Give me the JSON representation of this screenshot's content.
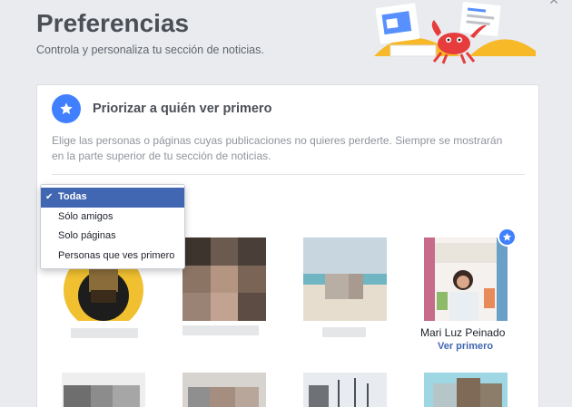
{
  "header": {
    "title": "Preferencias",
    "subtitle": "Controla y personaliza tu sección de noticias."
  },
  "section": {
    "title": "Priorizar a quién ver primero",
    "description": "Elige las personas o páginas cuyas publicaciones no quieres perderte. Siempre se mostrarán en la parte superior de tu sección de noticias."
  },
  "filter": {
    "options": [
      "Todas",
      "Sólo amigos",
      "Solo páginas",
      "Personas que ves primero"
    ],
    "selected": "Todas"
  },
  "people": [
    {
      "name": "",
      "see_first": false
    },
    {
      "name": "",
      "see_first": false
    },
    {
      "name": "",
      "see_first": false
    },
    {
      "name": "Mari Luz Peinado",
      "see_first": true,
      "action_label": "Ver primero"
    }
  ],
  "icons": {
    "section": "star-icon",
    "selected_mark": "checkmark-icon",
    "see_first_badge": "star-icon",
    "close": "close-icon"
  },
  "colors": {
    "accent": "#4080ff",
    "selected_bg": "#4267b2",
    "link": "#4267b2",
    "page_bg": "#e9ebee"
  }
}
